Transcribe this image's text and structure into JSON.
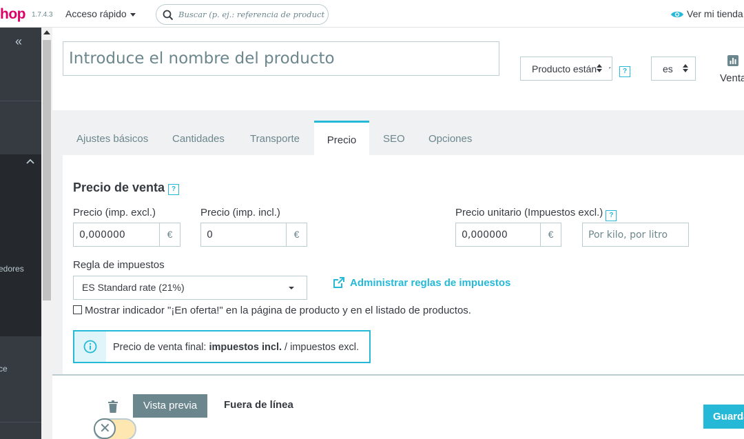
{
  "header": {
    "logo_text": "hop",
    "version": "1.7.4.3",
    "quick_access": "Acceso rápido",
    "search_placeholder": "Buscar (p. ej.: referencia de producto, nombre de cliente...)",
    "view_shop": "Ver mi tienda"
  },
  "sidebar": {
    "labels": [
      "edores",
      "ce"
    ]
  },
  "product": {
    "name_placeholder": "Introduce el nombre del producto",
    "type_select": "Producto estándar",
    "lang_select": "es",
    "sales_label": "Ventas"
  },
  "tabs": [
    {
      "label": "Ajustes básicos"
    },
    {
      "label": "Cantidades"
    },
    {
      "label": "Transporte"
    },
    {
      "label": "Precio"
    },
    {
      "label": "SEO"
    },
    {
      "label": "Opciones"
    }
  ],
  "pricing": {
    "section_title": "Precio de venta",
    "help_glyph": "?",
    "price_excl_label": "Precio (imp. excl.)",
    "price_excl_value": "0,000000",
    "price_incl_label": "Precio (imp. incl.)",
    "price_incl_value": "0",
    "currency": "€",
    "unit_price_label": "Precio unitario (Impuestos excl.)",
    "unit_price_value": "0,000000",
    "unit_placeholder": "Por kilo, por litro",
    "tax_rule_label": "Regla de impuestos",
    "tax_rule_value": "ES Standard rate (21%)",
    "manage_tax_link": "Administrar reglas de impuestos",
    "on_sale_label": "Mostrar indicador \"¡En oferta!\" en la página de producto y en el listado de productos.",
    "final_price_prefix": "Precio de venta final: ",
    "final_price_bold": "impuestos incl.",
    "final_price_suffix": " / impuestos excl."
  },
  "footer": {
    "preview_button": "Vista previa",
    "offline_label": "Fuera de línea",
    "save_button": "Guardar"
  },
  "colors": {
    "accent": "#25b9d7",
    "brand": "#df0067",
    "sidebar": "#363a41",
    "toggle_off": "#fee7b0"
  }
}
